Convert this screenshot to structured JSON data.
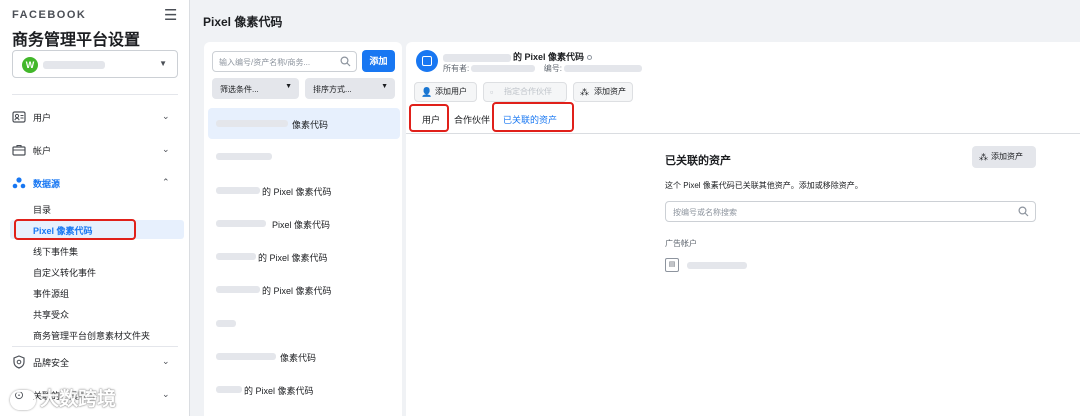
{
  "sidebar": {
    "brand": "FACEBOOK",
    "title": "商务管理平台设置",
    "account_avatar_letter": "W",
    "nav": [
      {
        "label": "用户",
        "icon": "user-card-icon"
      },
      {
        "label": "帐户",
        "icon": "briefcase-icon"
      },
      {
        "label": "数据源",
        "icon": "data-sources-icon"
      }
    ],
    "data_sources_items": [
      "目录",
      "Pixel 像素代码",
      "线下事件集",
      "自定义转化事件",
      "事件源组",
      "共享受众",
      "商务管理平台创意素材文件夹"
    ],
    "brand_safety": "品牌安全",
    "integrations": "关联的工具账号"
  },
  "watermark": "大数跨境",
  "header": {
    "title": "Pixel 像素代码"
  },
  "list": {
    "search_placeholder": "输入编号/资产名称/商务...",
    "add_label": "添加",
    "filter_label": "筛选条件...",
    "sort_label": "排序方式...",
    "rows": [
      "像素代码",
      "",
      "的 Pixel 像素代码",
      "Pixel 像素代码",
      "的 Pixel 像素代码",
      "的 Pixel 像素代码",
      "",
      "像素代码",
      "的 Pixel 像素代码"
    ]
  },
  "detail": {
    "title_suffix": "的 Pixel 像素代码",
    "owner_label": "所有者:",
    "id_label": "编号:",
    "actions": {
      "add_user": "添加用户",
      "assign_partner": "指定合作伙伴",
      "add_asset": "添加资产"
    },
    "tabs": [
      "用户",
      "合作伙伴",
      "已关联的资产"
    ],
    "assets": {
      "title": "已关联的资产",
      "add_button": "添加资产",
      "description": "这个 Pixel 像素代码已关联其他资产。添加或移除资产。",
      "search_placeholder": "按编号或名称搜索",
      "section_label": "广告帐户"
    }
  },
  "colors": {
    "accent": "#1877f2",
    "highlight": "#e0201a",
    "avatar_green": "#42b72a"
  }
}
